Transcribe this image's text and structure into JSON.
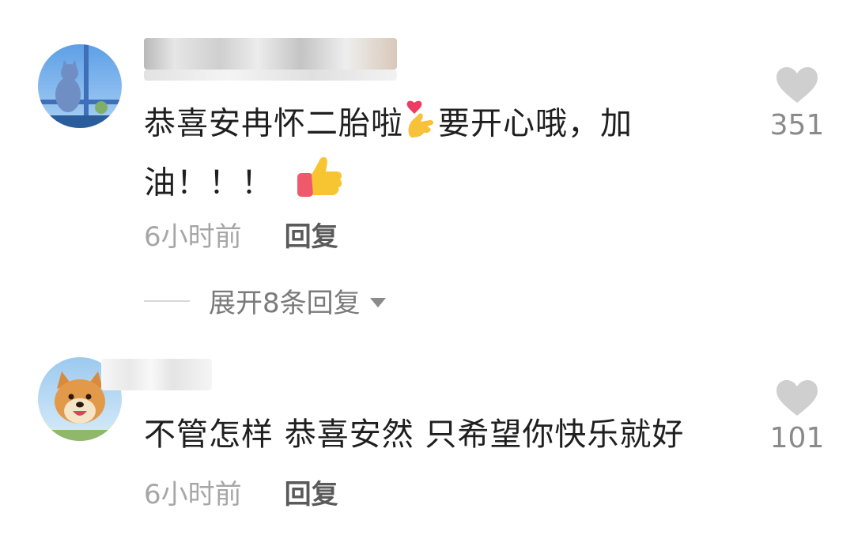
{
  "comments": [
    {
      "avatar_icon": "cat-on-window-avatar",
      "text_part1": "恭喜安冉怀二胎啦",
      "emoji1": "finger-heart-emoji",
      "text_part2": "要开心哦，加",
      "text_line2": "油！！！",
      "emoji2": "thumbs-up-emoji",
      "time": "6小时前",
      "reply_label": "回复",
      "like_icon": "heart-icon",
      "like_count": "351",
      "expand_label": "展开8条回复",
      "expand_icon": "caret-down-icon"
    },
    {
      "avatar_icon": "shiba-dog-avatar",
      "text": "不管怎样 恭喜安然 只希望你快乐就好",
      "time": "6小时前",
      "reply_label": "回复",
      "like_icon": "heart-icon",
      "like_count": "101"
    }
  ],
  "colors": {
    "text": "#1f1f1f",
    "meta": "#a6a6a6",
    "reply": "#5a5a5a",
    "heart": "#cfcfcf",
    "count": "#8a8a8a"
  }
}
